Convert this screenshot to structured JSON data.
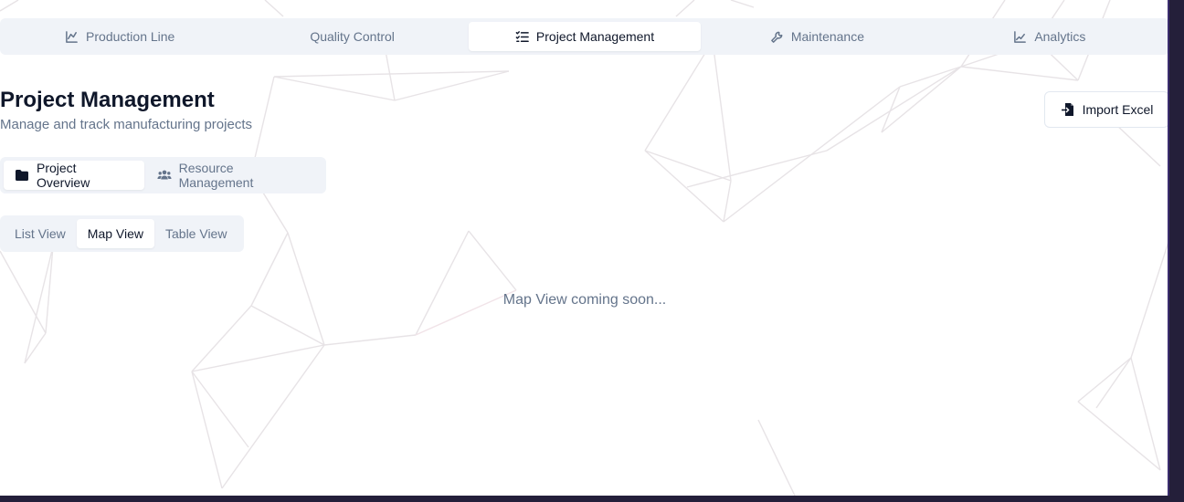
{
  "module_tabs": [
    {
      "label": "Production Line",
      "icon": "chart-line-icon"
    },
    {
      "label": "Quality Control",
      "icon": ""
    },
    {
      "label": "Project Management",
      "icon": "list-checks-icon"
    },
    {
      "label": "Maintenance",
      "icon": "wrench-icon"
    },
    {
      "label": "Analytics",
      "icon": "trend-icon"
    }
  ],
  "header": {
    "title": "Project Management",
    "subtitle": "Manage and track manufacturing projects",
    "import_label": "Import Excel"
  },
  "section_tabs": [
    {
      "label": "Project Overview",
      "icon": "folder-icon"
    },
    {
      "label": "Resource Management",
      "icon": "users-icon"
    }
  ],
  "view_tabs": [
    {
      "label": "List View"
    },
    {
      "label": "Map View"
    },
    {
      "label": "Table View"
    }
  ],
  "content": {
    "message": "Map View coming soon..."
  },
  "colors": {
    "accent_text": "#0f172a",
    "muted_text": "#64748b",
    "tab_background": "#f0f3f8",
    "frame": "#241f3a"
  }
}
